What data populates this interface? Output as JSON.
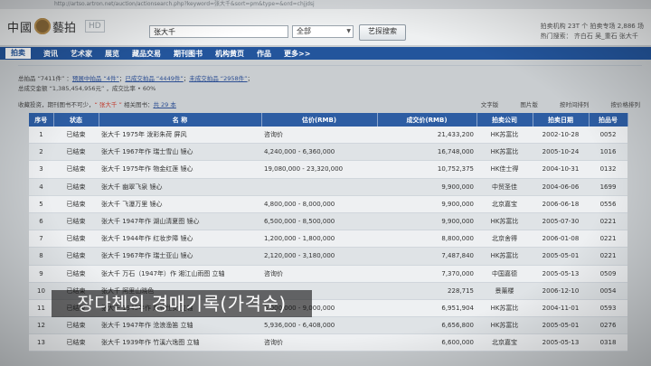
{
  "browser": {
    "url": "http://artso.artron.net/auction/actionsearch.php?keyword=张大千&sort=pm&type=&ord=chjjdsj"
  },
  "header": {
    "logo_text_left": "中國",
    "logo_text_right": "藝拍",
    "hd_badge": "HD",
    "search_value": "张大千",
    "select_value": "全部",
    "search_button": "艺探搜索",
    "right_line1": "拍卖机构 23T 个  拍卖专场 2,886 场",
    "right_line2": "热门搜索：  齐白石   吴_重石  张大千"
  },
  "nav": {
    "items": [
      "拍卖",
      "资讯",
      "艺术家",
      "展览",
      "藏品交易",
      "期刊图书",
      "机构黄页",
      "作品",
      "更多>>"
    ]
  },
  "summary": {
    "line1_prefix": "总拍品 “7411件” ：",
    "link1": "预展中拍品 “4件”",
    "sep1": "；",
    "link2": "已成交拍品 “4449件”",
    "sep2": "；",
    "link3": "未成交拍品 “2958件”",
    "line1_suffix": "；",
    "line2": "总成交金额 “1,385,454,956元” ，成交比率 • 60%"
  },
  "notice": {
    "text": "收藏投资，期刊图书不可少，",
    "keyword": "“ 张大千 ”",
    "related": " 相关图书：",
    "count_link": "共 29 本"
  },
  "view_links": [
    "文字版",
    "图片版",
    "按时间排列",
    "按价格排列"
  ],
  "table": {
    "headers": [
      "序号",
      "状态",
      "名 称",
      "估价(RMB)",
      "成交价(RMB)",
      "拍卖公司",
      "拍卖日期",
      "拍品号"
    ],
    "rows": [
      [
        "1",
        "已结束",
        "张大千 1975年 泼彩朱荷 屏风",
        "咨询价",
        "21,433,200",
        "HK苏富比",
        "2002-10-28",
        "0052"
      ],
      [
        "2",
        "已结束",
        "张大千 1967年作 瑞士雪山 镜心",
        "4,240,000 - 6,360,000",
        "16,748,000",
        "HK苏富比",
        "2005-10-24",
        "1016"
      ],
      [
        "3",
        "已结束",
        "张大千 1975年作 物金红莲 镜心",
        "19,080,000 - 23,320,000",
        "10,752,375",
        "HK佳士得",
        "2004-10-31",
        "0132"
      ],
      [
        "4",
        "已结束",
        "张大千 幽翠飞泉 镜心",
        "",
        "9,900,000",
        "中贸圣佳",
        "2004-06-06",
        "1699"
      ],
      [
        "5",
        "已结束",
        "张大千 飞瀑万里 镜心",
        "4,800,000 - 8,000,000",
        "9,900,000",
        "北京嘉宝",
        "2006-06-18",
        "0556"
      ],
      [
        "6",
        "已结束",
        "张大千 1947年作 湖山清夏图 镜心",
        "6,500,000 - 8,500,000",
        "9,900,000",
        "HK苏富比",
        "2005-07-30",
        "0221"
      ],
      [
        "7",
        "已结束",
        "张大千 1944年作 红妆步障 镜心",
        "1,200,000 - 1,800,000",
        "8,800,000",
        "北京舍得",
        "2006-01-08",
        "0221"
      ],
      [
        "8",
        "已结束",
        "张大千 1967年作 瑞士亚山 镜心",
        "2,120,000 - 3,180,000",
        "7,487,840",
        "HK苏富比",
        "2005-05-01",
        "0221"
      ],
      [
        "9",
        "已结束",
        "张大千 万石（1947年）作 湘江山雨图 立轴",
        "咨询价",
        "7,370,000",
        "中国嘉德",
        "2005-05-13",
        "0509"
      ],
      [
        "10",
        "已结束",
        "张大千 阿里山晓色",
        "",
        "228,715",
        "景薰楼",
        "2006-12-10",
        "0054"
      ],
      [
        "11",
        "已结束",
        "张大千 1945年作 摩登仕女 立轴",
        "6,000,000 - 9,000,000",
        "6,951,904",
        "HK苏富比",
        "2004-11-01",
        "0593"
      ],
      [
        "12",
        "已结束",
        "张大千 1947年作 沧浪渔笛 立轴",
        "5,936,000 - 6,408,000",
        "6,656,800",
        "HK苏富比",
        "2005-05-01",
        "0276"
      ],
      [
        "13",
        "已结束",
        "张大千 1939年作 竹溪六逸图 立轴",
        "咨询价",
        "6,600,000",
        "北京嘉宝",
        "2005-05-13",
        "0318"
      ]
    ]
  },
  "caption": "장다첸의 경매기록(가격순)"
}
